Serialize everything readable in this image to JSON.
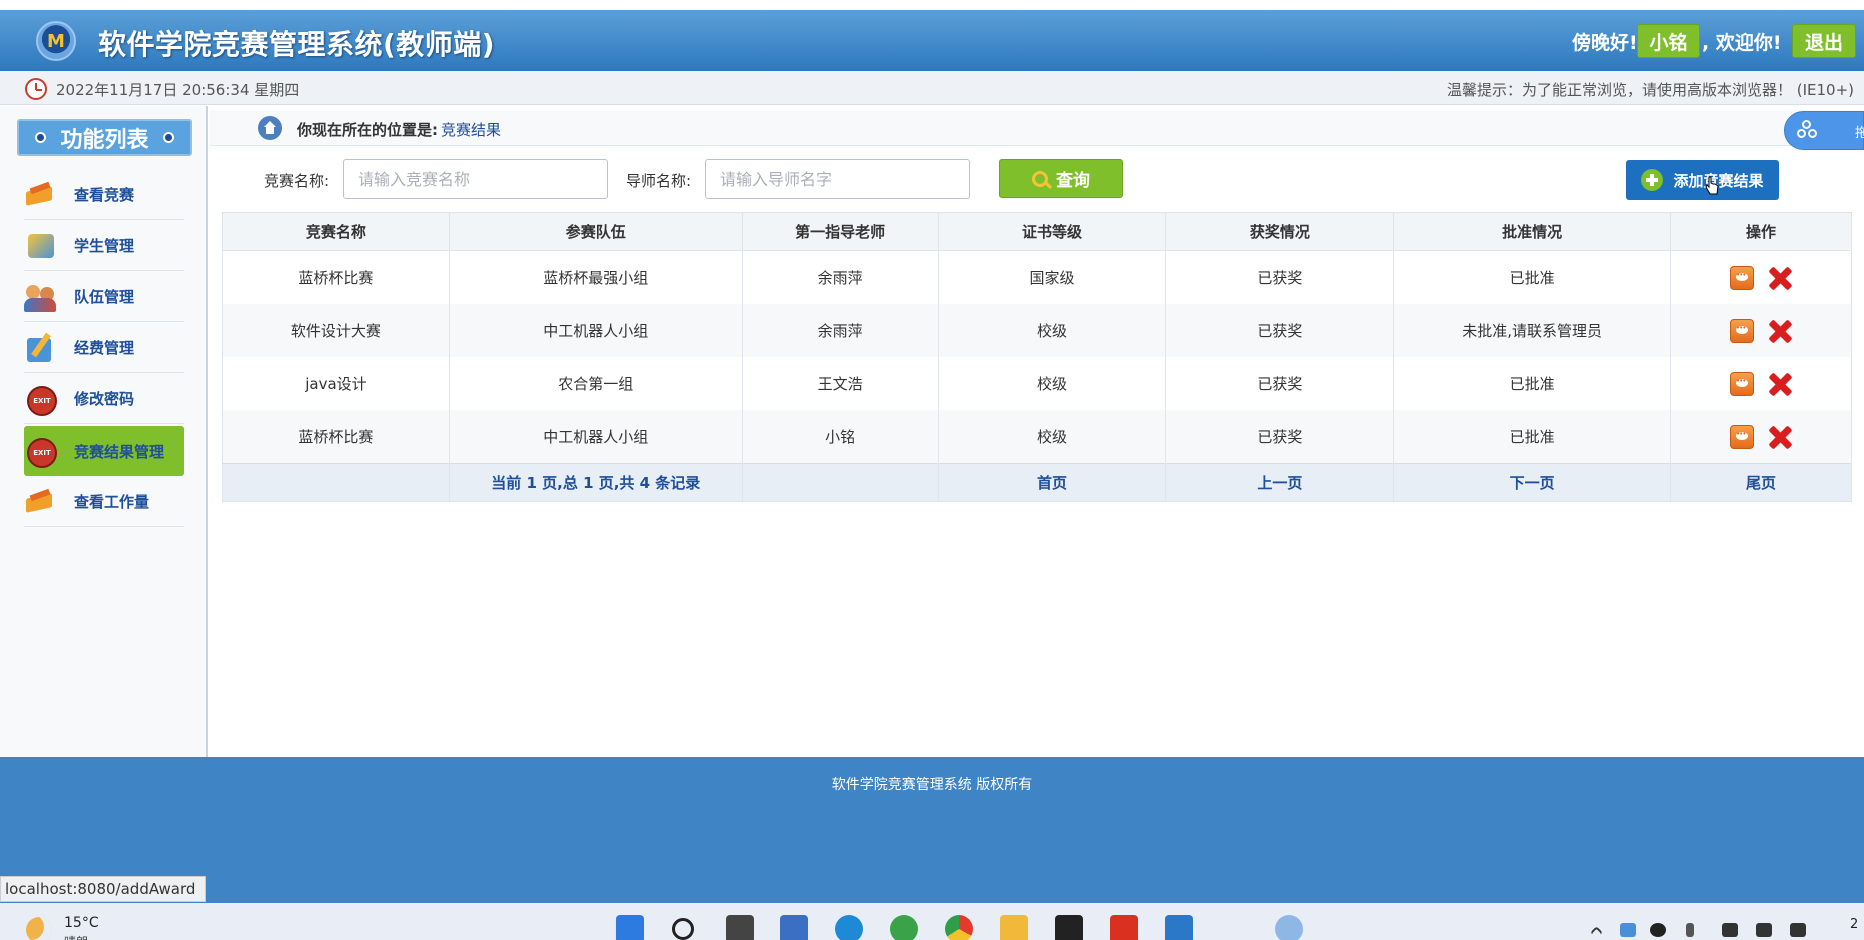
{
  "header": {
    "logo_text": "M",
    "title": "软件学院竞赛管理系统(教师端)",
    "greeting_prefix": "傍晚好!",
    "user_name": "小铭",
    "greeting_suffix": ", 欢迎你!",
    "logout_label": "退出"
  },
  "infobar": {
    "datetime": "2022年11月17日 20:56:34 星期四",
    "tip": "温馨提示：为了能正常浏览，请使用高版本浏览器！ (IE10+)"
  },
  "sidebar": {
    "title": "功能列表",
    "items": [
      {
        "label": "查看竞赛",
        "icon": "book-icon"
      },
      {
        "label": "学生管理",
        "icon": "students-icon"
      },
      {
        "label": "队伍管理",
        "icon": "team-icon"
      },
      {
        "label": "经费管理",
        "icon": "fee-icon"
      },
      {
        "label": "修改密码",
        "icon": "exit-icon"
      },
      {
        "label": "竞赛结果管理",
        "icon": "exit-icon",
        "active": true
      },
      {
        "label": "查看工作量",
        "icon": "book-icon"
      }
    ]
  },
  "breadcrumb": {
    "prefix": "你现在所在的位置是:",
    "current": "竞赛结果"
  },
  "baidu_tab": {
    "label": "拖"
  },
  "search": {
    "competition_label": "竞赛名称:",
    "competition_placeholder": "请输入竞赛名称",
    "mentor_label": "导师名称:",
    "mentor_placeholder": "请输入导师名字",
    "query_label": "查询",
    "add_label": "添加竞赛结果"
  },
  "table": {
    "headers": [
      "竞赛名称",
      "参赛队伍",
      "第一指导老师",
      "证书等级",
      "获奖情况",
      "批准情况",
      "操作"
    ],
    "rows": [
      [
        "蓝桥杯比赛",
        "蓝桥杯最强小组",
        "余雨萍",
        "国家级",
        "已获奖",
        "已批准"
      ],
      [
        "软件设计大赛",
        "中工机器人小组",
        "余雨萍",
        "校级",
        "已获奖",
        "未批准,请联系管理员"
      ],
      [
        "java设计",
        "农合第一组",
        "王文浩",
        "校级",
        "已获奖",
        "已批准"
      ],
      [
        "蓝桥杯比赛",
        "中工机器人小组",
        "小铭",
        "校级",
        "已获奖",
        "已批准"
      ]
    ],
    "pagination": {
      "summary": "当前 1 页,总 1 页,共 4 条记录",
      "first": "首页",
      "prev": "上一页",
      "next": "下一页",
      "last": "尾页"
    }
  },
  "footer": {
    "copyright": "软件学院竞赛管理系统 版权所有"
  },
  "status_url": "localhost:8080/addAward",
  "taskbar": {
    "temperature": "15°C",
    "weather": "晴朗",
    "clock_peek": "2"
  },
  "colors": {
    "header_blue": "#2d79be",
    "accent_green": "#7fbf2b",
    "primary_blue": "#1d6fc0",
    "footer_blue": "#3f84c4"
  }
}
